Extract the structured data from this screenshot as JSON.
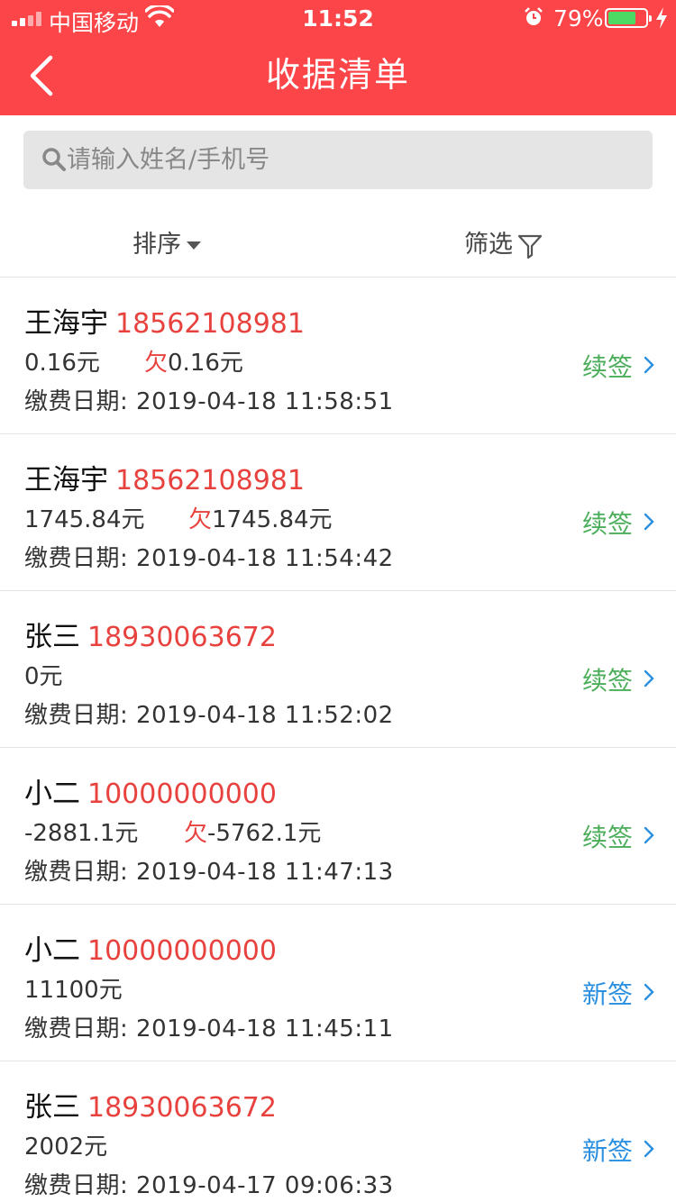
{
  "status_bar": {
    "carrier": "中国移动",
    "time": "11:52",
    "battery": "79%"
  },
  "nav": {
    "title": "收据清单"
  },
  "search": {
    "placeholder": "请输入姓名/手机号"
  },
  "toolbar": {
    "sort_label": "排序",
    "filter_label": "筛选"
  },
  "colors": {
    "header": "#fb4548",
    "phone": "#e8423f",
    "renew": "#4cae5a",
    "new_sign": "#2a8fe0"
  },
  "records": [
    {
      "name": "王海宇",
      "phone": "18562108981",
      "amount": "0.16元",
      "owe_label": "欠",
      "owe_amount": "0.16元",
      "date_label": "缴费日期:",
      "date": "2019-04-18 11:58:51",
      "action": "续签",
      "action_type": "renew"
    },
    {
      "name": "王海宇",
      "phone": "18562108981",
      "amount": "1745.84元",
      "owe_label": "欠",
      "owe_amount": "1745.84元",
      "date_label": "缴费日期:",
      "date": "2019-04-18 11:54:42",
      "action": "续签",
      "action_type": "renew"
    },
    {
      "name": "张三",
      "phone": "18930063672",
      "amount": "0元",
      "owe_label": "",
      "owe_amount": "",
      "date_label": "缴费日期:",
      "date": "2019-04-18 11:52:02",
      "action": "续签",
      "action_type": "renew"
    },
    {
      "name": "小二",
      "phone": "10000000000",
      "amount": "-2881.1元",
      "owe_label": "欠",
      "owe_amount": "-5762.1元",
      "date_label": "缴费日期:",
      "date": "2019-04-18 11:47:13",
      "action": "续签",
      "action_type": "renew"
    },
    {
      "name": "小二",
      "phone": "10000000000",
      "amount": "11100元",
      "owe_label": "",
      "owe_amount": "",
      "date_label": "缴费日期:",
      "date": "2019-04-18 11:45:11",
      "action": "新签",
      "action_type": "new"
    },
    {
      "name": "张三",
      "phone": "18930063672",
      "amount": "2002元",
      "owe_label": "",
      "owe_amount": "",
      "date_label": "缴费日期:",
      "date": "2019-04-17 09:06:33",
      "action": "新签",
      "action_type": "new"
    }
  ]
}
